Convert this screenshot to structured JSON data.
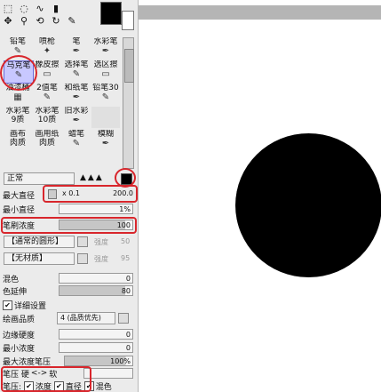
{
  "tool_icons": [
    "⬚",
    "◌",
    "∿",
    "▮",
    "✥",
    "⚲",
    "⟲",
    "↻",
    "✎"
  ],
  "brushes": [
    {
      "label": "铅笔",
      "icon": "✎"
    },
    {
      "label": "喷枪",
      "icon": "✦"
    },
    {
      "label": "笔",
      "icon": "✒"
    },
    {
      "label": "水彩笔",
      "icon": "✒"
    },
    {
      "label": "马克笔",
      "icon": "✎"
    },
    {
      "label": "橡皮擦",
      "icon": "▭"
    },
    {
      "label": "选择笔",
      "icon": "✎"
    },
    {
      "label": "选区擦",
      "icon": "▭"
    },
    {
      "label": "油漆桶",
      "icon": "▦"
    },
    {
      "label": "2值笔",
      "icon": "✎"
    },
    {
      "label": "和纸笔",
      "icon": "✒"
    },
    {
      "label": "铅笔30",
      "icon": "✎"
    },
    {
      "label": "水彩笔",
      "icon": "✒"
    },
    {
      "label": "水彩笔",
      "icon": "✒"
    },
    {
      "label": "旧水彩",
      "icon": "✒"
    },
    {
      "label": "",
      "icon": ""
    },
    {
      "label": "画布",
      "icon": "▦"
    },
    {
      "label": "画用纸",
      "icon": "▦"
    },
    {
      "label": "蜡笔",
      "icon": "✎"
    },
    {
      "label": "模糊",
      "icon": "✒"
    }
  ],
  "brush_sub": {
    "a": "9质",
    "b": "10质",
    "c": "肉质",
    "d": "肉质"
  },
  "blend_mode": "正常",
  "max_size": {
    "label": "最大直径",
    "mult": "x 0.1",
    "value": "200.0"
  },
  "min_size": {
    "label": "最小直径",
    "value": "1%"
  },
  "density": {
    "label": "笔刷浓度",
    "value": "100"
  },
  "shape": {
    "label": "【通常的圆形】",
    "extra": "强度",
    "extra_val": "50"
  },
  "texture": {
    "label": "【无材质】",
    "extra": "强度",
    "extra_val": "95"
  },
  "blending": {
    "label": "混色",
    "value": "0"
  },
  "dilution": {
    "label": "色延伸",
    "value": "80"
  },
  "advanced": {
    "label": "详细设置",
    "check": "✔"
  },
  "quality": {
    "label": "绘画品质",
    "value": "4 (品质优先)"
  },
  "hardness": {
    "label": "边缘硬度",
    "value": "0"
  },
  "min_density": {
    "label": "最小浓度",
    "value": "0"
  },
  "max_pressure": {
    "label": "最大浓度笔压",
    "value": "100%"
  },
  "pressure": {
    "label1": "笔压",
    "hard": "硬",
    "arrow": "<->",
    "soft": "软"
  },
  "bottom": {
    "label": "笔压:",
    "density": "浓度",
    "size": "直径",
    "blend": "混色",
    "check": "✔"
  }
}
